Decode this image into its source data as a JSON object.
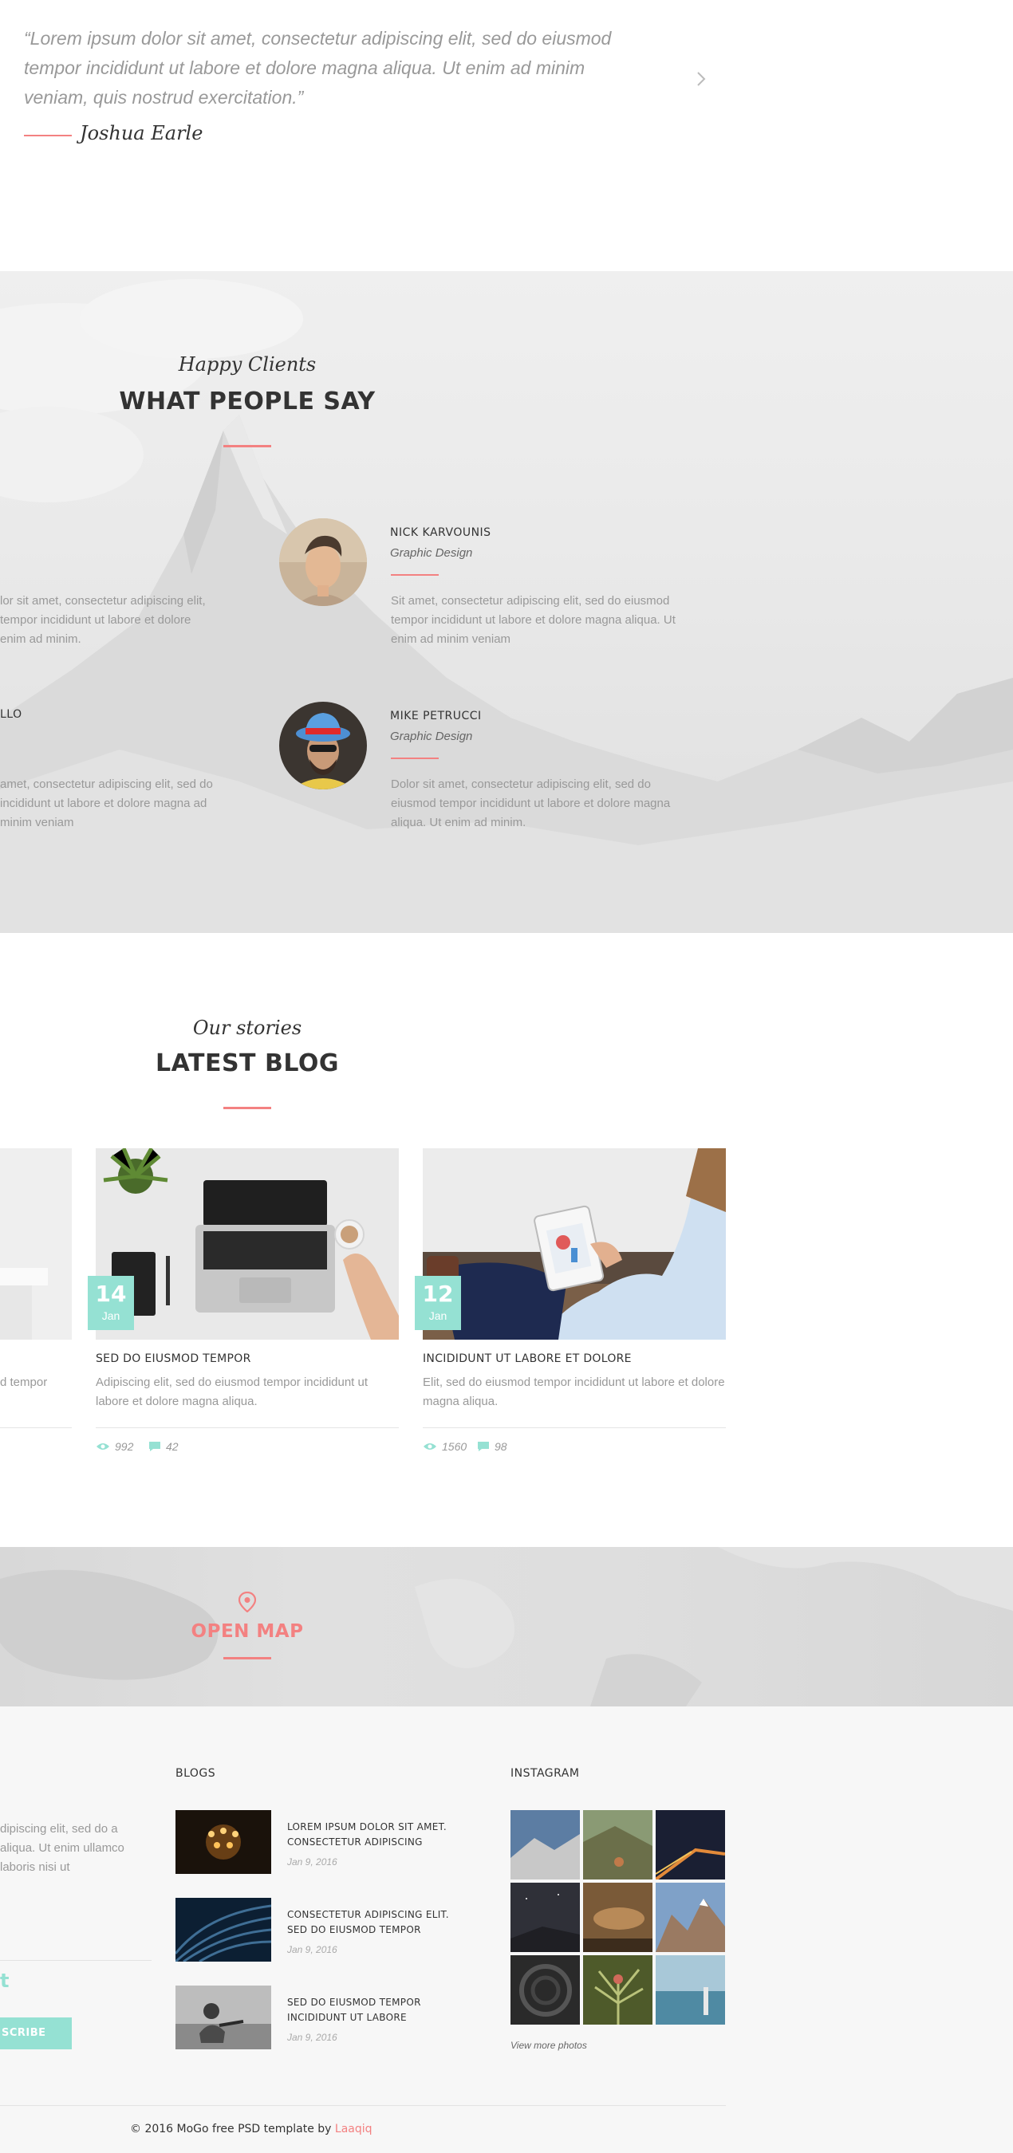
{
  "quote": {
    "text": "“Lorem ipsum dolor sit amet, consectetur adipiscing elit, sed do eiusmod tempor incididunt ut labore et dolore magna aliqua. Ut enim ad minim veniam, quis nostrud exercitation.”",
    "author": "Joshua Earle",
    "next_icon": "chevron-right-icon"
  },
  "clients": {
    "subtitle": "Happy Clients",
    "title": "WHAT PEOPLE SAY",
    "left_partial": [
      {
        "body": "lor sit amet, consectetur adipiscing elit, tempor incididunt ut labore et dolore enim ad minim."
      },
      {
        "name": "LLO",
        "body": "amet, consectetur adipiscing elit, sed do incididunt ut labore et dolore magna ad minim veniam"
      }
    ],
    "items": [
      {
        "name": "NICK KARVOUNIS",
        "role": "Graphic Design",
        "body": "Sit amet, consectetur adipiscing elit, sed do eiusmod tempor incididunt ut labore et dolore magna aliqua. Ut enim ad minim veniam"
      },
      {
        "name": "MIKE PETRUCCI",
        "role": "Graphic Design",
        "body": "Dolor sit amet, consectetur adipiscing elit, sed do eiusmod tempor incididunt ut labore et dolore magna aliqua. Ut enim ad minim."
      }
    ]
  },
  "blog": {
    "subtitle": "Our stories",
    "title": "LATEST BLOG",
    "left_partial_body": "d tempor",
    "posts": [
      {
        "day": "14",
        "month": "Jan",
        "title": "SED DO EIUSMOD TEMPOR",
        "body": "Adipiscing elit, sed do eiusmod tempor incididunt ut labore et dolore magna aliqua.",
        "views": "992",
        "comments": "42"
      },
      {
        "day": "12",
        "month": "Jan",
        "title": "INCIDIDUNT UT LABORE ET DOLORE",
        "body": "Elit, sed do eiusmod tempor incididunt ut labore et dolore magna aliqua.",
        "views": "1560",
        "comments": "98"
      }
    ]
  },
  "map": {
    "label": "OPEN MAP",
    "icon": "map-pin-icon"
  },
  "footer": {
    "about_partial": "dipiscing elit, sed do a aliqua. Ut enim ullamco laboris nisi ut",
    "newsletter_partial": "t",
    "subscribe_label": "SCRIBE",
    "blogs_heading": "BLOGS",
    "blog_items": [
      {
        "title": "LOREM IPSUM DOLOR SIT AMET. CONSECTETUR ADIPISCING",
        "date": "Jan 9, 2016"
      },
      {
        "title": "CONSECTETUR ADIPISCING ELIT. SED DO EIUSMOD TEMPOR",
        "date": "Jan 9, 2016"
      },
      {
        "title": "SED DO EIUSMOD TEMPOR INCIDIDUNT UT LABORE",
        "date": "Jan 9, 2016"
      }
    ],
    "instagram_heading": "INSTAGRAM",
    "view_more": "View more photos",
    "copyright_prefix": "© 2016 MoGo free PSD template by ",
    "copyright_brand": "Laaqiq"
  },
  "colors": {
    "accent": "#f38181",
    "teal": "#95e1d3"
  }
}
